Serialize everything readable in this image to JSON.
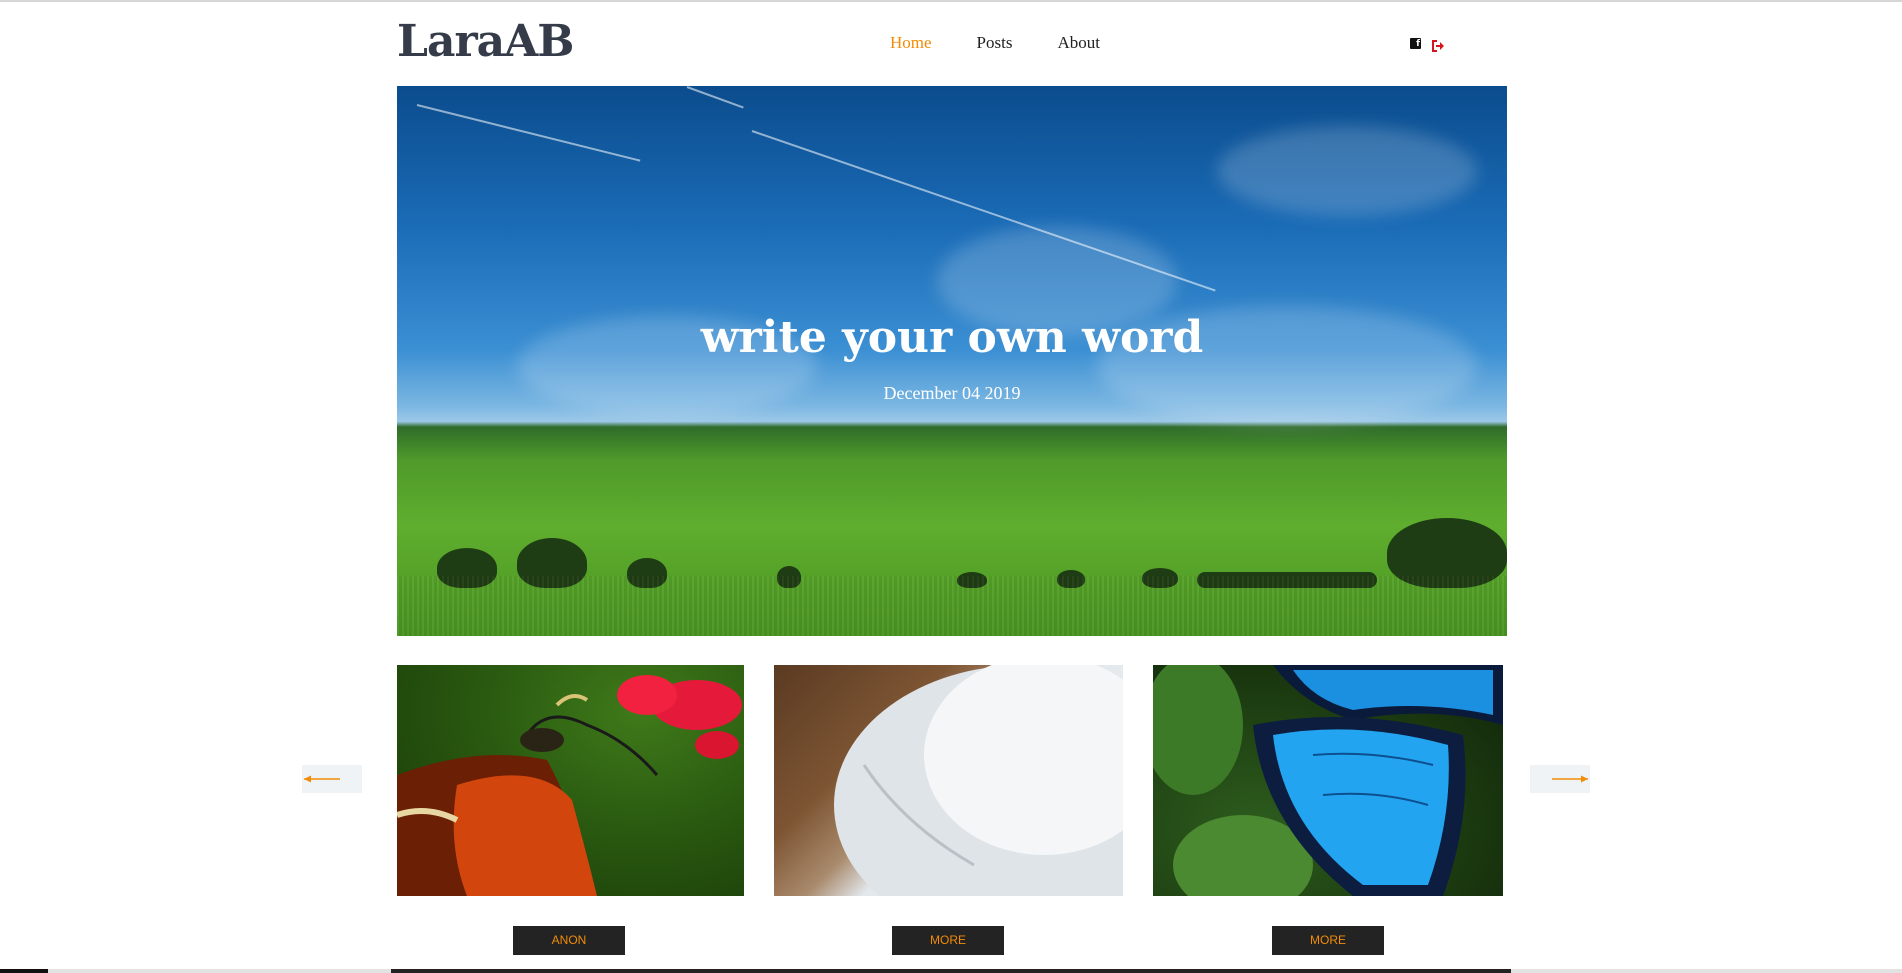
{
  "brand": {
    "name": "LaraAB",
    "accent": "#f28c06"
  },
  "nav": {
    "items": [
      {
        "label": "Home",
        "active": true
      },
      {
        "label": "Posts",
        "active": false
      },
      {
        "label": "About",
        "active": false
      }
    ]
  },
  "social": {
    "icons": [
      "facebook-icon",
      "logout-icon"
    ]
  },
  "hero": {
    "title": "write your own word",
    "date": "December 04 2019"
  },
  "cards": [
    {
      "image": "butterfly-flower",
      "button": "ANON"
    },
    {
      "image": "white-cup",
      "button": "MORE"
    },
    {
      "image": "blue-butterfly",
      "button": "MORE"
    }
  ],
  "carousel": {
    "prev_icon": "arrow-left-icon",
    "next_icon": "arrow-right-icon"
  }
}
